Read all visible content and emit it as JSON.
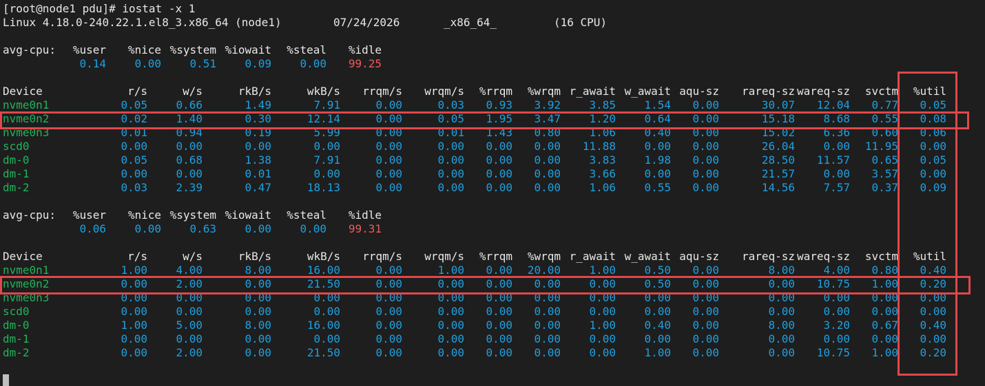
{
  "prompt_line": "[root@node1 pdu]# iostat -x 1",
  "sysinfo": {
    "kernel": "Linux 4.18.0-240.22.1.el8_3.x86_64 (node1)",
    "date": "07/24/2026",
    "arch": "_x86_64_",
    "cpus": "(16 CPU)"
  },
  "cpu_headers": [
    "avg-cpu:",
    "%user",
    "%nice",
    "%system",
    "%iowait",
    "%steal",
    "%idle"
  ],
  "device_headers": [
    "Device",
    "r/s",
    "w/s",
    "rkB/s",
    "wkB/s",
    "rrqm/s",
    "wrqm/s",
    "%rrqm",
    "%wrqm",
    "r_await",
    "w_await",
    "aqu-sz",
    "rareq-sz",
    "wareq-sz",
    "svctm",
    "%util"
  ],
  "reports": [
    {
      "cpu": {
        "user": "0.14",
        "nice": "0.00",
        "system": "0.51",
        "iowait": "0.09",
        "steal": "0.00",
        "idle": "99.25"
      },
      "devices": [
        {
          "name": "nvme0n1",
          "vals": [
            "0.05",
            "0.66",
            "1.49",
            "7.91",
            "0.00",
            "0.03",
            "0.93",
            "3.92",
            "3.85",
            "1.54",
            "0.00",
            "30.07",
            "12.04",
            "0.77",
            "0.05"
          ]
        },
        {
          "name": "nvme0n2",
          "vals": [
            "0.02",
            "1.40",
            "0.30",
            "12.14",
            "0.00",
            "0.05",
            "1.95",
            "3.47",
            "1.20",
            "0.64",
            "0.00",
            "15.18",
            "8.68",
            "0.55",
            "0.08"
          ]
        },
        {
          "name": "nvme0n3",
          "vals": [
            "0.01",
            "0.94",
            "0.19",
            "5.99",
            "0.00",
            "0.01",
            "1.43",
            "0.80",
            "1.06",
            "0.40",
            "0.00",
            "15.02",
            "6.36",
            "0.60",
            "0.06"
          ]
        },
        {
          "name": "scd0",
          "vals": [
            "0.00",
            "0.00",
            "0.00",
            "0.00",
            "0.00",
            "0.00",
            "0.00",
            "0.00",
            "11.88",
            "0.00",
            "0.00",
            "26.04",
            "0.00",
            "11.95",
            "0.00"
          ]
        },
        {
          "name": "dm-0",
          "vals": [
            "0.05",
            "0.68",
            "1.38",
            "7.91",
            "0.00",
            "0.00",
            "0.00",
            "0.00",
            "3.83",
            "1.98",
            "0.00",
            "28.50",
            "11.57",
            "0.65",
            "0.05"
          ]
        },
        {
          "name": "dm-1",
          "vals": [
            "0.00",
            "0.00",
            "0.01",
            "0.00",
            "0.00",
            "0.00",
            "0.00",
            "0.00",
            "3.66",
            "0.00",
            "0.00",
            "21.57",
            "0.00",
            "3.57",
            "0.00"
          ]
        },
        {
          "name": "dm-2",
          "vals": [
            "0.03",
            "2.39",
            "0.47",
            "18.13",
            "0.00",
            "0.00",
            "0.00",
            "0.00",
            "1.06",
            "0.55",
            "0.00",
            "14.56",
            "7.57",
            "0.37",
            "0.09"
          ]
        }
      ]
    },
    {
      "cpu": {
        "user": "0.06",
        "nice": "0.00",
        "system": "0.63",
        "iowait": "0.00",
        "steal": "0.00",
        "idle": "99.31"
      },
      "devices": [
        {
          "name": "nvme0n1",
          "vals": [
            "1.00",
            "4.00",
            "8.00",
            "16.00",
            "0.00",
            "1.00",
            "0.00",
            "20.00",
            "1.00",
            "0.50",
            "0.00",
            "8.00",
            "4.00",
            "0.80",
            "0.40"
          ]
        },
        {
          "name": "nvme0n2",
          "vals": [
            "0.00",
            "2.00",
            "0.00",
            "21.50",
            "0.00",
            "0.00",
            "0.00",
            "0.00",
            "0.00",
            "0.50",
            "0.00",
            "0.00",
            "10.75",
            "1.00",
            "0.20"
          ]
        },
        {
          "name": "nvme0n3",
          "vals": [
            "0.00",
            "0.00",
            "0.00",
            "0.00",
            "0.00",
            "0.00",
            "0.00",
            "0.00",
            "0.00",
            "0.00",
            "0.00",
            "0.00",
            "0.00",
            "0.00",
            "0.00"
          ]
        },
        {
          "name": "scd0",
          "vals": [
            "0.00",
            "0.00",
            "0.00",
            "0.00",
            "0.00",
            "0.00",
            "0.00",
            "0.00",
            "0.00",
            "0.00",
            "0.00",
            "0.00",
            "0.00",
            "0.00",
            "0.00"
          ]
        },
        {
          "name": "dm-0",
          "vals": [
            "1.00",
            "5.00",
            "8.00",
            "16.00",
            "0.00",
            "0.00",
            "0.00",
            "0.00",
            "1.00",
            "0.40",
            "0.00",
            "8.00",
            "3.20",
            "0.67",
            "0.40"
          ]
        },
        {
          "name": "dm-1",
          "vals": [
            "0.00",
            "0.00",
            "0.00",
            "0.00",
            "0.00",
            "0.00",
            "0.00",
            "0.00",
            "0.00",
            "0.00",
            "0.00",
            "0.00",
            "0.00",
            "0.00",
            "0.00"
          ]
        },
        {
          "name": "dm-2",
          "vals": [
            "0.00",
            "2.00",
            "0.00",
            "21.50",
            "0.00",
            "0.00",
            "0.00",
            "0.00",
            "0.00",
            "1.00",
            "0.00",
            "0.00",
            "10.75",
            "1.00",
            "0.20"
          ]
        }
      ]
    }
  ],
  "colors": {
    "background": "#1e1e1e",
    "device_name": "#20b45a",
    "value": "#1fa0e0",
    "idle": "#ef5a5a",
    "highlight_box": "#e0484b"
  }
}
